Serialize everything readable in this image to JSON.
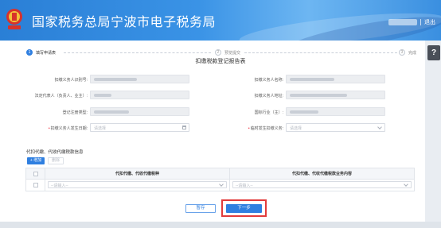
{
  "header": {
    "title": "国家税务总局宁波市电子税务局",
    "logout": "退出"
  },
  "help": {
    "label": "?"
  },
  "steps": [
    {
      "num": "1",
      "label": "填写申请表",
      "state": "active"
    },
    {
      "num": "2",
      "label": "预览提交",
      "state": "todo"
    },
    {
      "num": "3",
      "label": "完成",
      "state": "todo"
    }
  ],
  "form": {
    "title": "扣缴税款登记报告表",
    "left": [
      {
        "label": "扣缴义务人识别号:",
        "required": false
      },
      {
        "label": "法定代表人（负责人、业主）:",
        "required": false
      },
      {
        "label": "登记注册类型:",
        "required": false
      },
      {
        "label": "扣缴义务人发生日期:",
        "required": true,
        "placeholder": "请选择"
      }
    ],
    "right": [
      {
        "label": "扣缴义务人名称:",
        "required": false
      },
      {
        "label": "扣缴义务人地址:",
        "required": false
      },
      {
        "label": "国标行业（主）:",
        "required": false
      },
      {
        "label": "临时发生扣缴义务:",
        "required": true,
        "placeholder": "请选择"
      }
    ]
  },
  "section": {
    "title": "代扣代缴、代收代缴税款信息",
    "add": "+ 增加",
    "delete": "删除"
  },
  "table": {
    "headers": [
      "代扣代缴、代收代缴税种",
      "代扣代缴、代收代缴税款业务内容"
    ],
    "row_placeholder": "--请输入--"
  },
  "actions": {
    "save": "暂存",
    "next": "下一步"
  },
  "colors": {
    "accent": "#2f7fe0",
    "highlight": "#e23b3b"
  }
}
